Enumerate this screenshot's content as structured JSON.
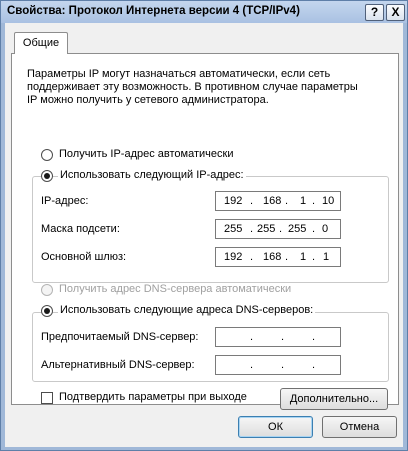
{
  "window": {
    "title": "Свойства: Протокол Интернета версии 4 (TCP/IPv4)",
    "help_label": "?",
    "close_label": "X"
  },
  "tabs": [
    {
      "label": "Общие",
      "active": true
    }
  ],
  "intro_lines": [
    "Параметры IP могут назначаться автоматически, если сеть",
    "поддерживает эту возможность. В противном случае параметры",
    "IP можно получить у сетевого администратора."
  ],
  "ip_section": {
    "auto_label": "Получить IP-адрес автоматически",
    "manual_label": "Использовать следующий IP-адрес:",
    "selected": "manual",
    "fields": [
      {
        "label": "IP-адрес:",
        "octets": [
          "192",
          "168",
          "1",
          "10"
        ]
      },
      {
        "label": "Маска подсети:",
        "octets": [
          "255",
          "255",
          "255",
          "0"
        ]
      },
      {
        "label": "Основной шлюз:",
        "octets": [
          "192",
          "168",
          "1",
          "1"
        ]
      }
    ]
  },
  "dns_section": {
    "auto_label": "Получить адрес DNS-сервера автоматически",
    "manual_label": "Использовать следующие адреса DNS-серверов:",
    "selected": "manual",
    "fields": [
      {
        "label": "Предпочитаемый DNS-сервер:",
        "octets": [
          "",
          "",
          "",
          ""
        ]
      },
      {
        "label": "Альтернативный DNS-сервер:",
        "octets": [
          "",
          "",
          "",
          ""
        ]
      }
    ]
  },
  "validate_label": "Подтвердить параметры при выходе",
  "validate_checked": false,
  "buttons": {
    "advanced": "Дополнительно...",
    "ok": "ОК",
    "cancel": "Отмена"
  },
  "ip_separator": "."
}
